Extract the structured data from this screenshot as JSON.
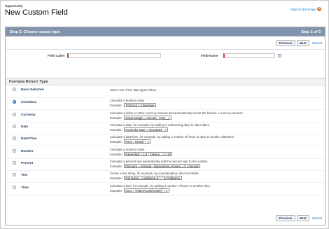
{
  "header": {
    "object_label": "Opportunity",
    "title": "New Custom Field",
    "help_link": "Help for this Page",
    "help_icon": "question-icon"
  },
  "step_bar": {
    "title": "Step 2. Choose output type",
    "step_count": "Step 2 of 5"
  },
  "buttons": {
    "previous": "Previous",
    "next": "Next",
    "cancel": "Cancel"
  },
  "fields": {
    "field_label": {
      "label": "Field Label",
      "value": ""
    },
    "field_name": {
      "label": "Field Name",
      "value": "",
      "info_icon": "i"
    }
  },
  "section": {
    "title": "Formula Return Type"
  },
  "types": [
    {
      "name": "None Selected",
      "selected": false,
      "description": "Select one of the data types below.",
      "example": ""
    },
    {
      "name": "Checkbox",
      "selected": true,
      "description": "Calculate a boolean value",
      "example": "TODAY() > CloseDate"
    },
    {
      "name": "Currency",
      "selected": false,
      "description": "Calculate a dollar or other currency amount and automatically format the field as a currency amount.",
      "example": "Gross Margin = Amount - Cost__c"
    },
    {
      "name": "Date",
      "selected": false,
      "description": "Calculate a date, for example, by adding or subtracting days to other dates.",
      "example": "Reminder Date = CloseDate - 7"
    },
    {
      "name": "Date/Time",
      "selected": false,
      "description": "Calculate a date/time, for example, by adding a number of hours or days to another date/time.",
      "example": "Next = NOW() + 1"
    },
    {
      "name": "Number",
      "selected": false,
      "description": "Calculate a numeric value.",
      "example": "Fahrenheit = 1.8 * Celsius__c + 32"
    },
    {
      "name": "Percent",
      "selected": false,
      "description": "Calculate a percent and automatically add the percent sign to the number.",
      "example": "Discount = (Amount - Discounted_Amount__c) / Amount"
    },
    {
      "name": "Text",
      "selected": false,
      "description": "Create a text string, for example, by concatenating other text fields.",
      "example": "Full Name = LastName & \", \" & FirstName"
    },
    {
      "name": "Time",
      "selected": false,
      "description": "Calculate a time, for example, by adding a number of hours to another time.",
      "example": "Next = TIMEVALUE(NOW()) + 1"
    }
  ],
  "example_prefix": "Example:"
}
